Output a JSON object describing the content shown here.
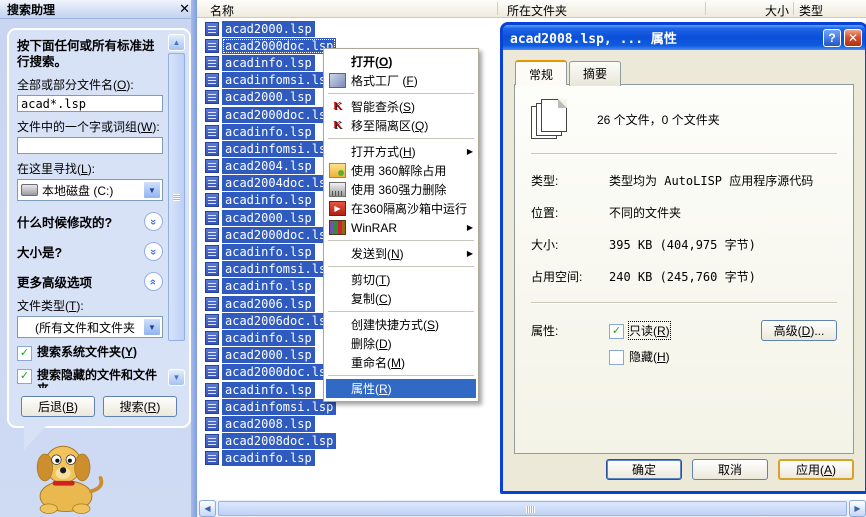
{
  "colors": {
    "selection_blue": "#316ac5",
    "dialog_titlebar_blue": "#0b50d6",
    "dialog_border_blue": "#0842d8",
    "panel_blue": "#d8e2f7",
    "xp_face": "#ece9d8",
    "apply_focus_gold": "#d9a02a",
    "check_green": "#21a121"
  },
  "search_panel": {
    "title": "搜索助理",
    "close_icon": "✕",
    "heading": "按下面任何或所有标准进行搜索。",
    "filename_label": "全部或部分文件名(O):",
    "filename_value": "acad*.lsp",
    "word_label": "文件中的一个字或词组(W):",
    "word_value": "",
    "look_in_label": "在这里寻找(L):",
    "look_in_value": "本地磁盘 (C:)",
    "modified_section": "什么时候修改的?",
    "size_section": "大小是?",
    "advanced_section": "更多高级选项",
    "file_type_label": "文件类型(T):",
    "file_type_value": "(所有文件和文件夹",
    "checkbox_system": {
      "label": "搜索系统文件夹(Y)",
      "checked": true
    },
    "checkbox_hidden": {
      "label": "搜索隐藏的文件和文件夹",
      "checked": true
    },
    "back_button": "后退(B)",
    "search_button": "搜索(R)",
    "check_glyph": "✓",
    "chevron_glyph": "»",
    "dropdown_glyph": "▼"
  },
  "file_list": {
    "columns": [
      "名称",
      "所在文件夹",
      "大小",
      "类型"
    ],
    "focused_index": 1,
    "files": [
      "acad2000.lsp",
      "acad2000doc.lsp",
      "acadinfo.lsp",
      "acadinfomsi.lsp",
      "acad2000.lsp",
      "acad2000doc.lsp",
      "acadinfo.lsp",
      "acadinfomsi.lsp",
      "acad2004.lsp",
      "acad2004doc.lsp",
      "acadinfo.lsp",
      "acad2000.lsp",
      "acad2000doc.lsp",
      "acadinfo.lsp",
      "acadinfomsi.lsp",
      "acadinfo.lsp",
      "acad2006.lsp",
      "acad2006doc.lsp",
      "acadinfo.lsp",
      "acad2000.lsp",
      "acad2000doc.lsp",
      "acadinfo.lsp",
      "acadinfomsi.lsp",
      "acad2008.lsp",
      "acad2008doc.lsp",
      "acadinfo.lsp"
    ]
  },
  "context_menu": {
    "items": [
      {
        "id": "open",
        "label": "打开(O)",
        "bold": true
      },
      {
        "id": "format-factory",
        "label": "格式工厂 (F)",
        "icon": "format-factory-icon"
      },
      {
        "separator": true
      },
      {
        "id": "kav-scan",
        "label": "智能查杀(S)",
        "icon": "kaspersky-icon"
      },
      {
        "id": "kav-quarantine",
        "label": "移至隔离区(Q)",
        "icon": "kaspersky-icon"
      },
      {
        "separator": true
      },
      {
        "id": "open-with",
        "label": "打开方式(H)",
        "submenu": true
      },
      {
        "id": "360-unlock",
        "label": "使用 360解除占用",
        "icon": "folder-360-icon"
      },
      {
        "id": "360-force-delete",
        "label": "使用 360强力删除",
        "icon": "shredder-360-icon"
      },
      {
        "id": "360-sandbox",
        "label": "在360隔离沙箱中运行",
        "icon": "sandbox-360-icon"
      },
      {
        "id": "winrar",
        "label": "WinRAR",
        "icon": "winrar-icon",
        "submenu": true
      },
      {
        "separator": true
      },
      {
        "id": "send-to",
        "label": "发送到(N)",
        "submenu": true
      },
      {
        "separator": true
      },
      {
        "id": "cut",
        "label": "剪切(T)"
      },
      {
        "id": "copy",
        "label": "复制(C)"
      },
      {
        "separator": true
      },
      {
        "id": "create-shortcut",
        "label": "创建快捷方式(S)"
      },
      {
        "id": "delete",
        "label": "删除(D)"
      },
      {
        "id": "rename",
        "label": "重命名(M)"
      },
      {
        "separator": true
      },
      {
        "id": "properties",
        "label": "属性(R)",
        "highlighted": true
      }
    ],
    "submenu_arrow_glyph": "▶"
  },
  "properties_dialog": {
    "title": "acad2008.lsp, ... 属性",
    "help_glyph": "?",
    "close_glyph": "✕",
    "tabs": [
      "常规",
      "摘要"
    ],
    "active_tab": "常规",
    "summary": "26 个文件，0 个文件夹",
    "info_rows": [
      {
        "label": "类型:",
        "value": "类型均为 AutoLISP 应用程序源代码"
      },
      {
        "label": "位置:",
        "value": "不同的文件夹"
      },
      {
        "label": "大小:",
        "value": "395 KB (404,975 字节)"
      },
      {
        "label": "占用空间:",
        "value": "240 KB (245,760 字节)"
      }
    ],
    "attributes_label": "属性:",
    "readonly": {
      "label": "只读(R)",
      "checked": true
    },
    "hidden": {
      "label": "隐藏(H)",
      "checked": false
    },
    "advanced_button": "高级(D)...",
    "ok_button": "确定",
    "cancel_button": "取消",
    "apply_button": "应用(A)",
    "check_glyph": "✓"
  },
  "scrollbars": {
    "h_left_glyph": "◀",
    "h_right_glyph": "▶",
    "v_up_glyph": "▲",
    "v_down_glyph": "▼"
  }
}
